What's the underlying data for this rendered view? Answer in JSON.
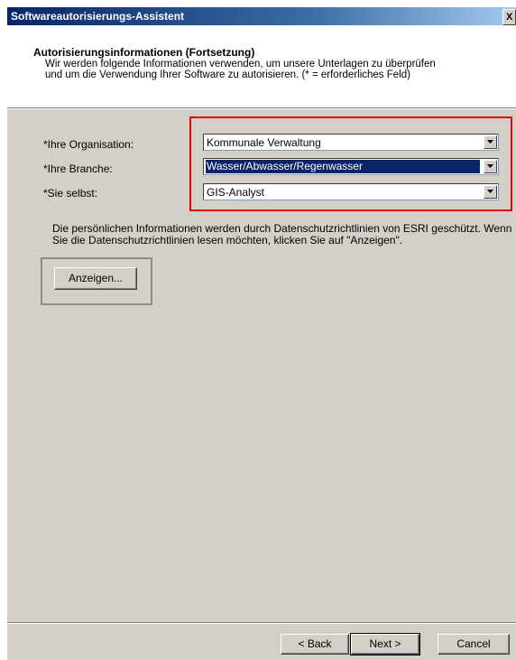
{
  "window": {
    "title": "Softwareautorisierungs-Assistent"
  },
  "header": {
    "title": "Autorisierungsinformationen (Fortsetzung)",
    "description": "Wir werden folgende Informationen verwenden, um unsere Unterlagen zu überprüfen und um die Verwendung Ihrer Software zu autorisieren. (* = erforderliches Feld)"
  },
  "form": {
    "organisation": {
      "label": "*Ihre Organisation:",
      "value": "Kommunale Verwaltung"
    },
    "branche": {
      "label": "*Ihre Branche:",
      "value": "Wasser/Abwasser/Regenwasser"
    },
    "selbst": {
      "label": "*Sie selbst:",
      "value": "GIS-Analyst"
    }
  },
  "info_text": "Die persönlichen Informationen werden durch Datenschutzrichtlinien von ESRI geschützt. Wenn Sie die Datenschutzrichtlinien lesen möchten, klicken Sie auf \"Anzeigen\".",
  "buttons": {
    "anzeigen": "Anzeigen...",
    "back": "< Back",
    "next": "Next >",
    "cancel": "Cancel"
  },
  "colors": {
    "titlebar": "#0a246a",
    "dialog_bg": "#d4d0c8",
    "highlight_box": "#e3000f",
    "selection": "#0a246a"
  },
  "icons": {
    "close": "close-icon",
    "dropdown": "chevron-down-icon"
  }
}
